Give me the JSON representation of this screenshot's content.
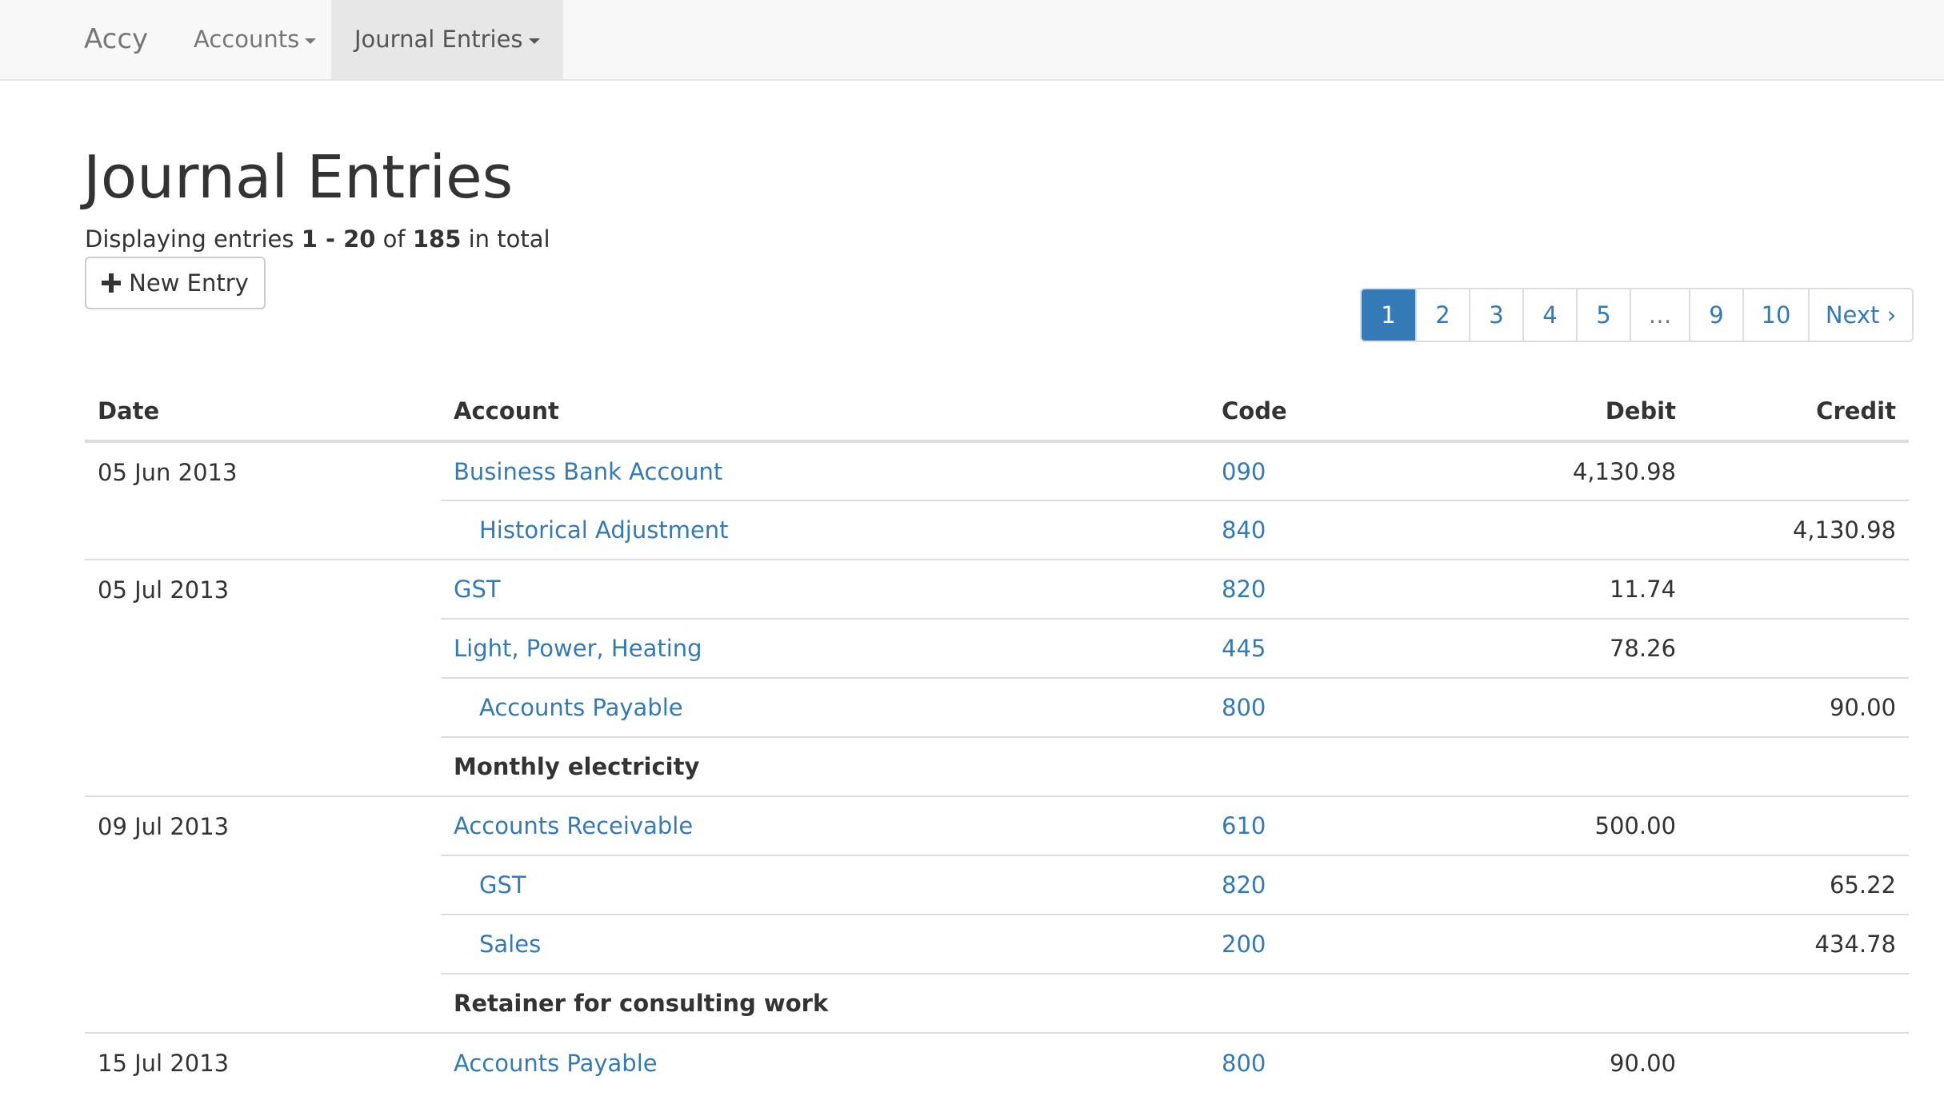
{
  "navbar": {
    "brand": "Accy",
    "items": [
      {
        "label": "Accounts",
        "active": false
      },
      {
        "label": "Journal Entries",
        "active": true
      }
    ]
  },
  "page": {
    "title": "Journal Entries",
    "summary": {
      "prefix": "Displaying entries ",
      "range": "1 - 20",
      "of": " of ",
      "total": "185",
      "suffix": " in total"
    },
    "new_entry_label": "New Entry"
  },
  "pagination": [
    "1",
    "2",
    "3",
    "4",
    "5",
    "…",
    "9",
    "10",
    "Next ›"
  ],
  "table": {
    "headers": {
      "date": "Date",
      "account": "Account",
      "code": "Code",
      "debit": "Debit",
      "credit": "Credit"
    },
    "entries": [
      {
        "date": "05 Jun 2013",
        "lines": [
          {
            "account": "Business Bank Account",
            "code": "090",
            "debit": "4,130.98",
            "credit": "",
            "indent": false
          },
          {
            "account": "Historical Adjustment",
            "code": "840",
            "debit": "",
            "credit": "4,130.98",
            "indent": true
          }
        ],
        "note": ""
      },
      {
        "date": "05 Jul 2013",
        "lines": [
          {
            "account": "GST",
            "code": "820",
            "debit": "11.74",
            "credit": "",
            "indent": false
          },
          {
            "account": "Light, Power, Heating",
            "code": "445",
            "debit": "78.26",
            "credit": "",
            "indent": false
          },
          {
            "account": "Accounts Payable",
            "code": "800",
            "debit": "",
            "credit": "90.00",
            "indent": true
          }
        ],
        "note": "Monthly electricity"
      },
      {
        "date": "09 Jul 2013",
        "lines": [
          {
            "account": "Accounts Receivable",
            "code": "610",
            "debit": "500.00",
            "credit": "",
            "indent": false
          },
          {
            "account": "GST",
            "code": "820",
            "debit": "",
            "credit": "65.22",
            "indent": true
          },
          {
            "account": "Sales",
            "code": "200",
            "debit": "",
            "credit": "434.78",
            "indent": true
          }
        ],
        "note": "Retainer for consulting work"
      },
      {
        "date": "15 Jul 2013",
        "lines": [
          {
            "account": "Accounts Payable",
            "code": "800",
            "debit": "90.00",
            "credit": "",
            "indent": false
          }
        ],
        "note": ""
      }
    ]
  }
}
